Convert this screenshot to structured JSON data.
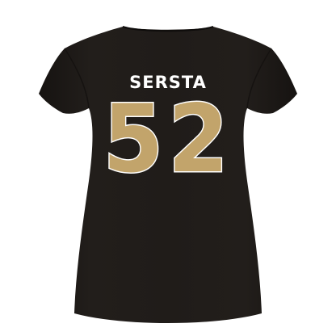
{
  "product": {
    "player_name": "SERSTA",
    "jersey_number": "52",
    "shirt_color": "#1e1a17",
    "number_color": "#c2a46b",
    "outline_color": "#ffffff",
    "background_color": "#ffffff"
  }
}
